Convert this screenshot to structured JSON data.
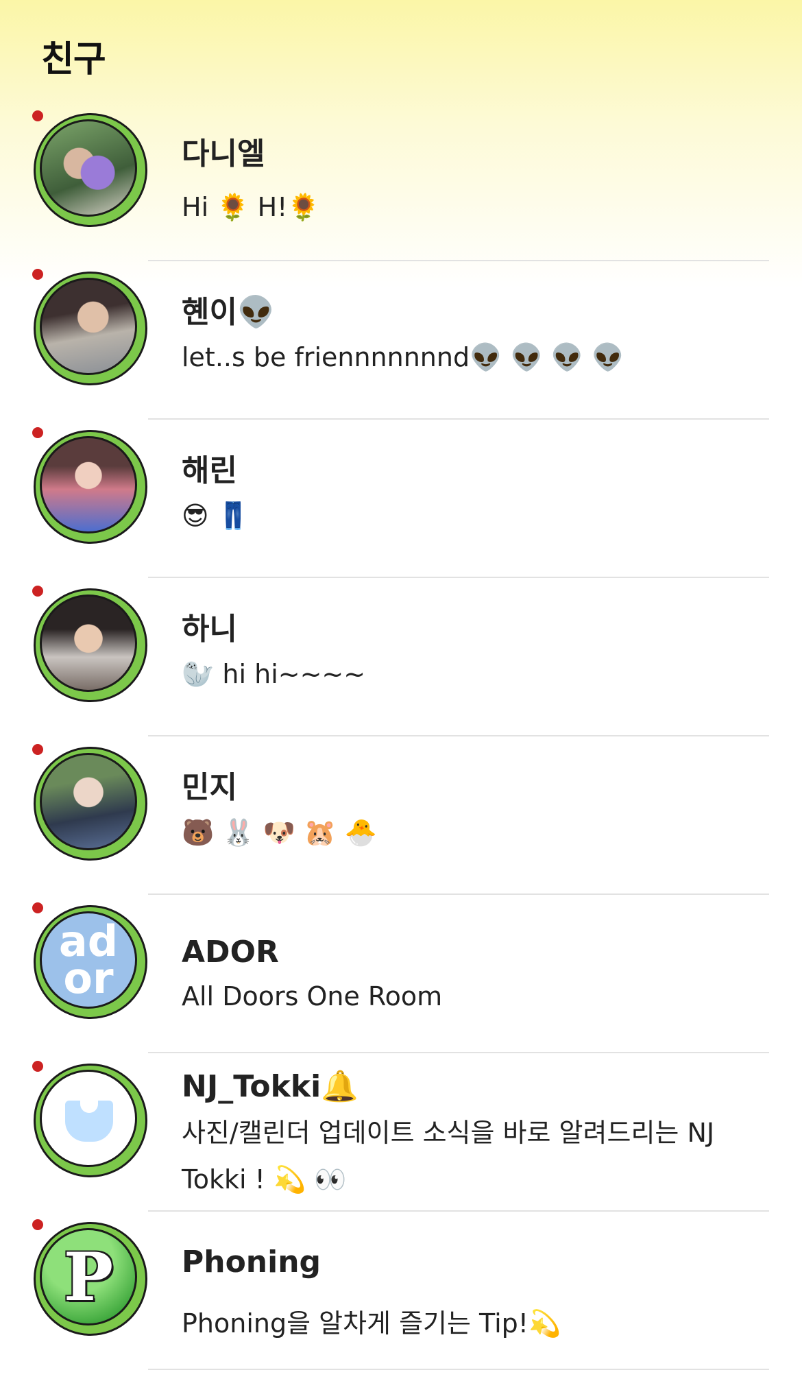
{
  "header": {
    "title": "친구"
  },
  "friends": [
    {
      "name": "다니엘",
      "status": " Hi 🌻  H!🌻",
      "unread": true
    },
    {
      "name": "혠이👽",
      "status": "let..s be friennnnnnnd👽 👽 👽 👽",
      "unread": true
    },
    {
      "name": "해린",
      "status": "😎 👖",
      "unread": true
    },
    {
      "name": "하니",
      "status": "🦭 hi hi~~~~",
      "unread": true
    },
    {
      "name": "민지",
      "status": "🐻 🐰 🐶 🐹 🐣",
      "unread": true
    },
    {
      "name": "ADOR",
      "status": "All Doors One Room",
      "unread": true,
      "avatar_text": "ad\nor"
    },
    {
      "name": "NJ_Tokki🔔",
      "status": "사진/캘린더 업데이트 소식을 바로 알려드리는 NJ Tokki ! 💫 👀",
      "unread": true
    },
    {
      "name": "Phoning",
      "status": "Phoning을 알차게 즐기는 Tip!💫",
      "unread": true,
      "avatar_text": "P"
    }
  ],
  "colors": {
    "avatar_ring": "#7cc84a",
    "unread_dot": "#cc2222",
    "header_gradient_top": "#fbf6a7"
  }
}
